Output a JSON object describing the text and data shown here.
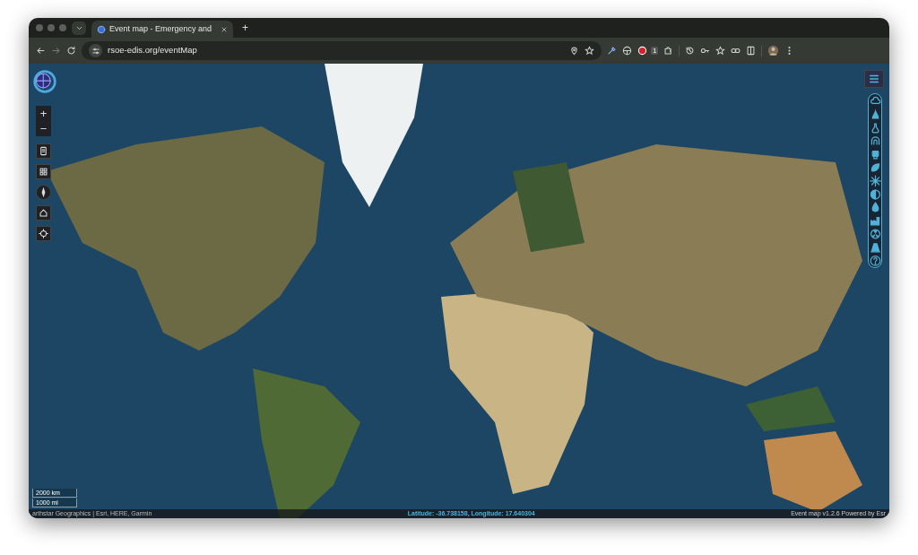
{
  "browser": {
    "tabs": [
      {
        "title": "Event map - Emergency and",
        "selected": true
      }
    ],
    "new_tab": "+",
    "address": "rsoe-edis.org/eventMap",
    "extension_badge": "1"
  },
  "map": {
    "zoom_in": "+",
    "zoom_out": "−",
    "scale": [
      "2000 km",
      "1000 mi"
    ],
    "attribution": "arthstar Geographics | Esri, HERE, Garmin",
    "coordinates": "Latitude: -36.738158, Longitude: 17.640304",
    "version": "Event map v1.2.6  Powered by Esr"
  }
}
